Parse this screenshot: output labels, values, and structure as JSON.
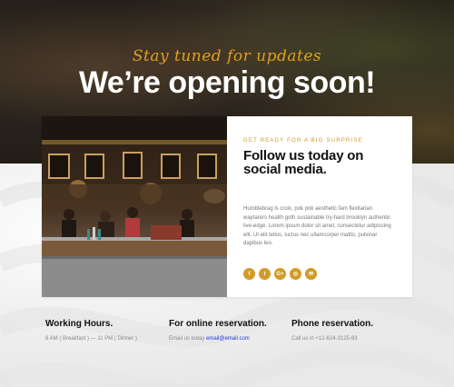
{
  "hero": {
    "tagline": "Stay tuned for updates",
    "headline": "We’re opening soon!"
  },
  "card": {
    "eyebrow": "GET READY FOR A BIG SURPRISE",
    "title": "Follow us today on social media.",
    "body": "Humblebrag ls croix, pok pok aesthetic fam flexitarian waytarers health goth sustainable try-hard brooklyn authentic live-edge. Lorem ipsum dolor sit amet, consectetur adipiscing elit. Ut elit tellus, luctus nec ullamcorper mattis, pulvinar dapibus leo.",
    "socials": [
      {
        "icon": "facebook-icon",
        "glyph": "f"
      },
      {
        "icon": "twitter-icon",
        "glyph": "t"
      },
      {
        "icon": "google-plus-icon",
        "glyph": "G+"
      },
      {
        "icon": "instagram-icon",
        "glyph": "◎"
      },
      {
        "icon": "email-icon",
        "glyph": "✉"
      }
    ]
  },
  "info": {
    "hours": {
      "title": "Working Hours.",
      "text": "8 AM ( Breakfast ) — 11 PM ( Dinner )"
    },
    "online": {
      "title": "For online reservation.",
      "prefix": "Email us today ",
      "email": "email@email.com"
    },
    "phone": {
      "title": "Phone reservation.",
      "text": "Call us in +12-624-3125-83"
    }
  },
  "colors": {
    "accent": "#d39a2a",
    "link": "#1a3ad8",
    "title": "#111111"
  }
}
